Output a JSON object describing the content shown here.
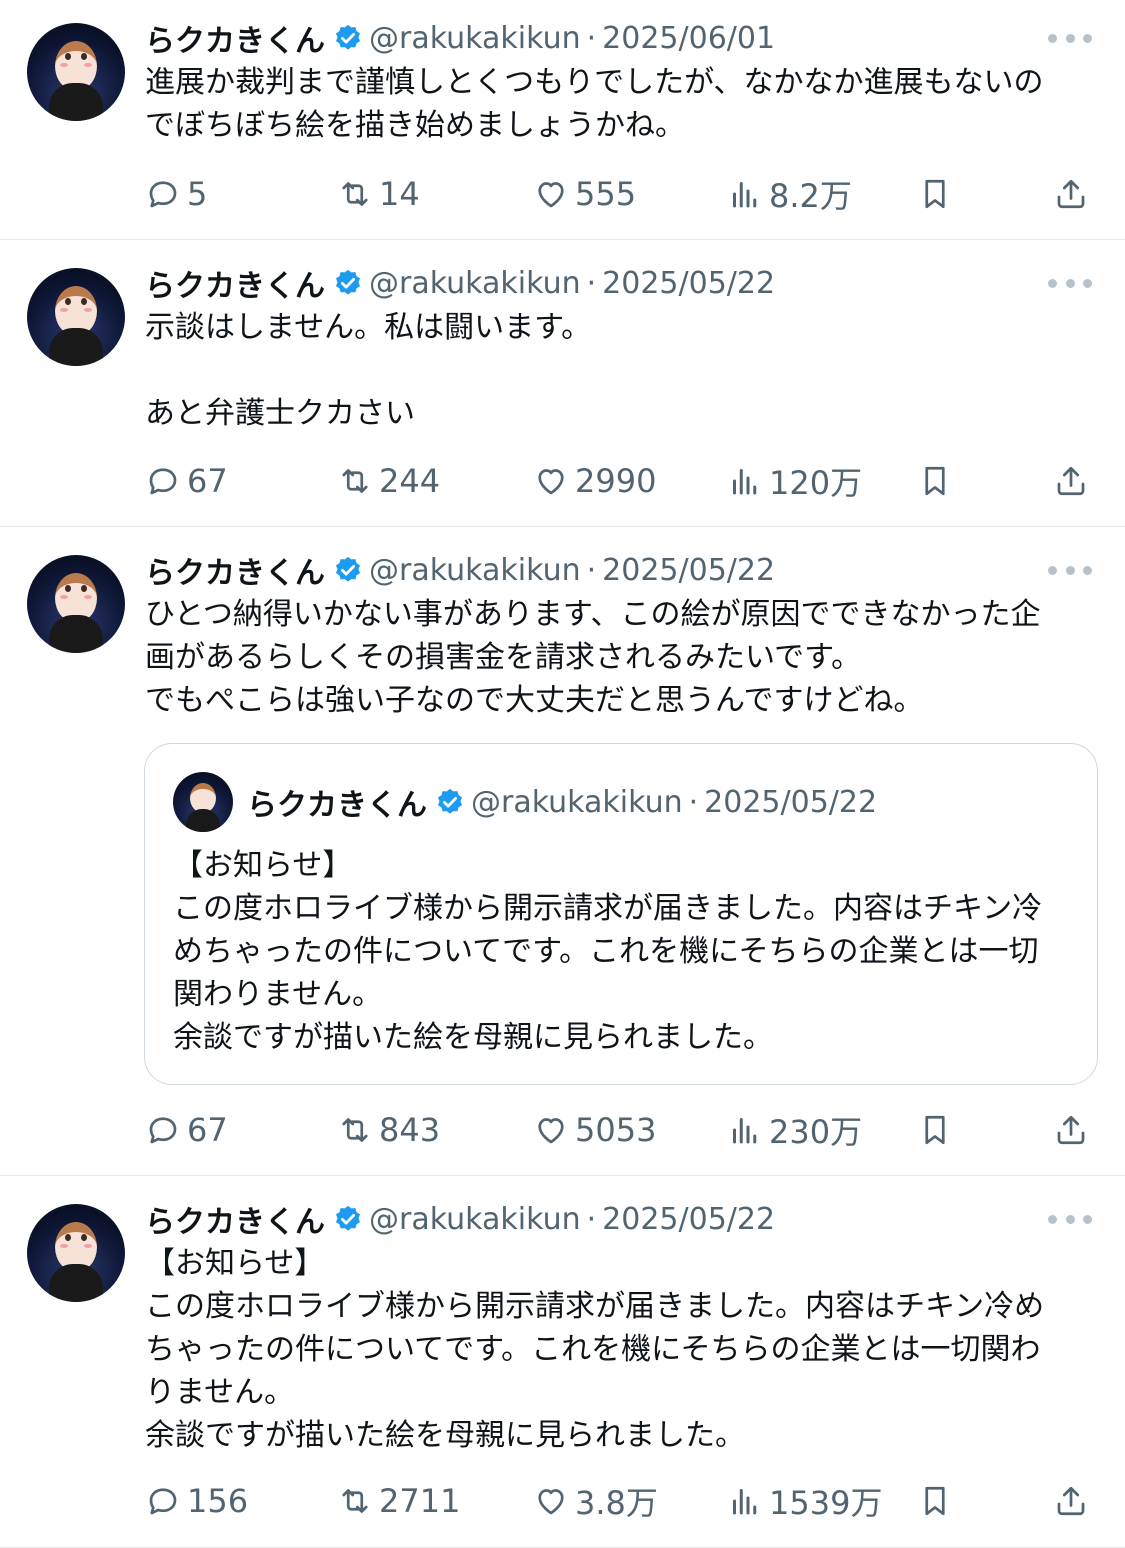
{
  "colors": {
    "accent": "#1d9bf0",
    "muted": "#536471",
    "text": "#0f1419"
  },
  "tweets": [
    {
      "name": "らクカきくん",
      "handle": "@rakukakikun",
      "sep": "·",
      "date": "2025/06/01",
      "lines": [
        "進展か裁判まで謹慎しとくつもりでしたが、なかなか進展もないの",
        "でぼちぼち絵を描き始めましょうかね。"
      ],
      "replies": "5",
      "retweets": "14",
      "likes": "555",
      "views": "8.2万"
    },
    {
      "name": "らクカきくん",
      "handle": "@rakukakikun",
      "sep": "·",
      "date": "2025/05/22",
      "lines": [
        "示談はしません。私は闘います。",
        "",
        "あと弁護士クカさい"
      ],
      "replies": "67",
      "retweets": "244",
      "likes": "2990",
      "views": "120万"
    },
    {
      "name": "らクカきくん",
      "handle": "@rakukakikun",
      "sep": "·",
      "date": "2025/05/22",
      "lines": [
        "ひとつ納得いかない事があります、この絵が原因でできなかった企",
        "画があるらしくその損害金を請求されるみたいです。",
        "でもぺこらは強い子なので大丈夫だと思うんですけどね。"
      ],
      "quote": {
        "name": "らクカきくん",
        "handle": "@rakukakikun",
        "sep": "·",
        "date": "2025/05/22",
        "lines": [
          "【お知らせ】",
          "この度ホロライブ様から開示請求が届きました。内容はチキン冷",
          "めちゃったの件についてです。これを機にそちらの企業とは一切",
          "関わりません。",
          "余談ですが描いた絵を母親に見られました。"
        ]
      },
      "replies": "67",
      "retweets": "843",
      "likes": "5053",
      "views": "230万"
    },
    {
      "name": "らクカきくん",
      "handle": "@rakukakikun",
      "sep": "·",
      "date": "2025/05/22",
      "lines": [
        "【お知らせ】",
        "この度ホロライブ様から開示請求が届きました。内容はチキン冷め",
        "ちゃったの件についてです。これを機にそちらの企業とは一切関わ",
        "りません。",
        "余談ですが描いた絵を母親に見られました。"
      ],
      "replies": "156",
      "retweets": "2711",
      "likes": "3.8万",
      "views": "1539万"
    }
  ]
}
